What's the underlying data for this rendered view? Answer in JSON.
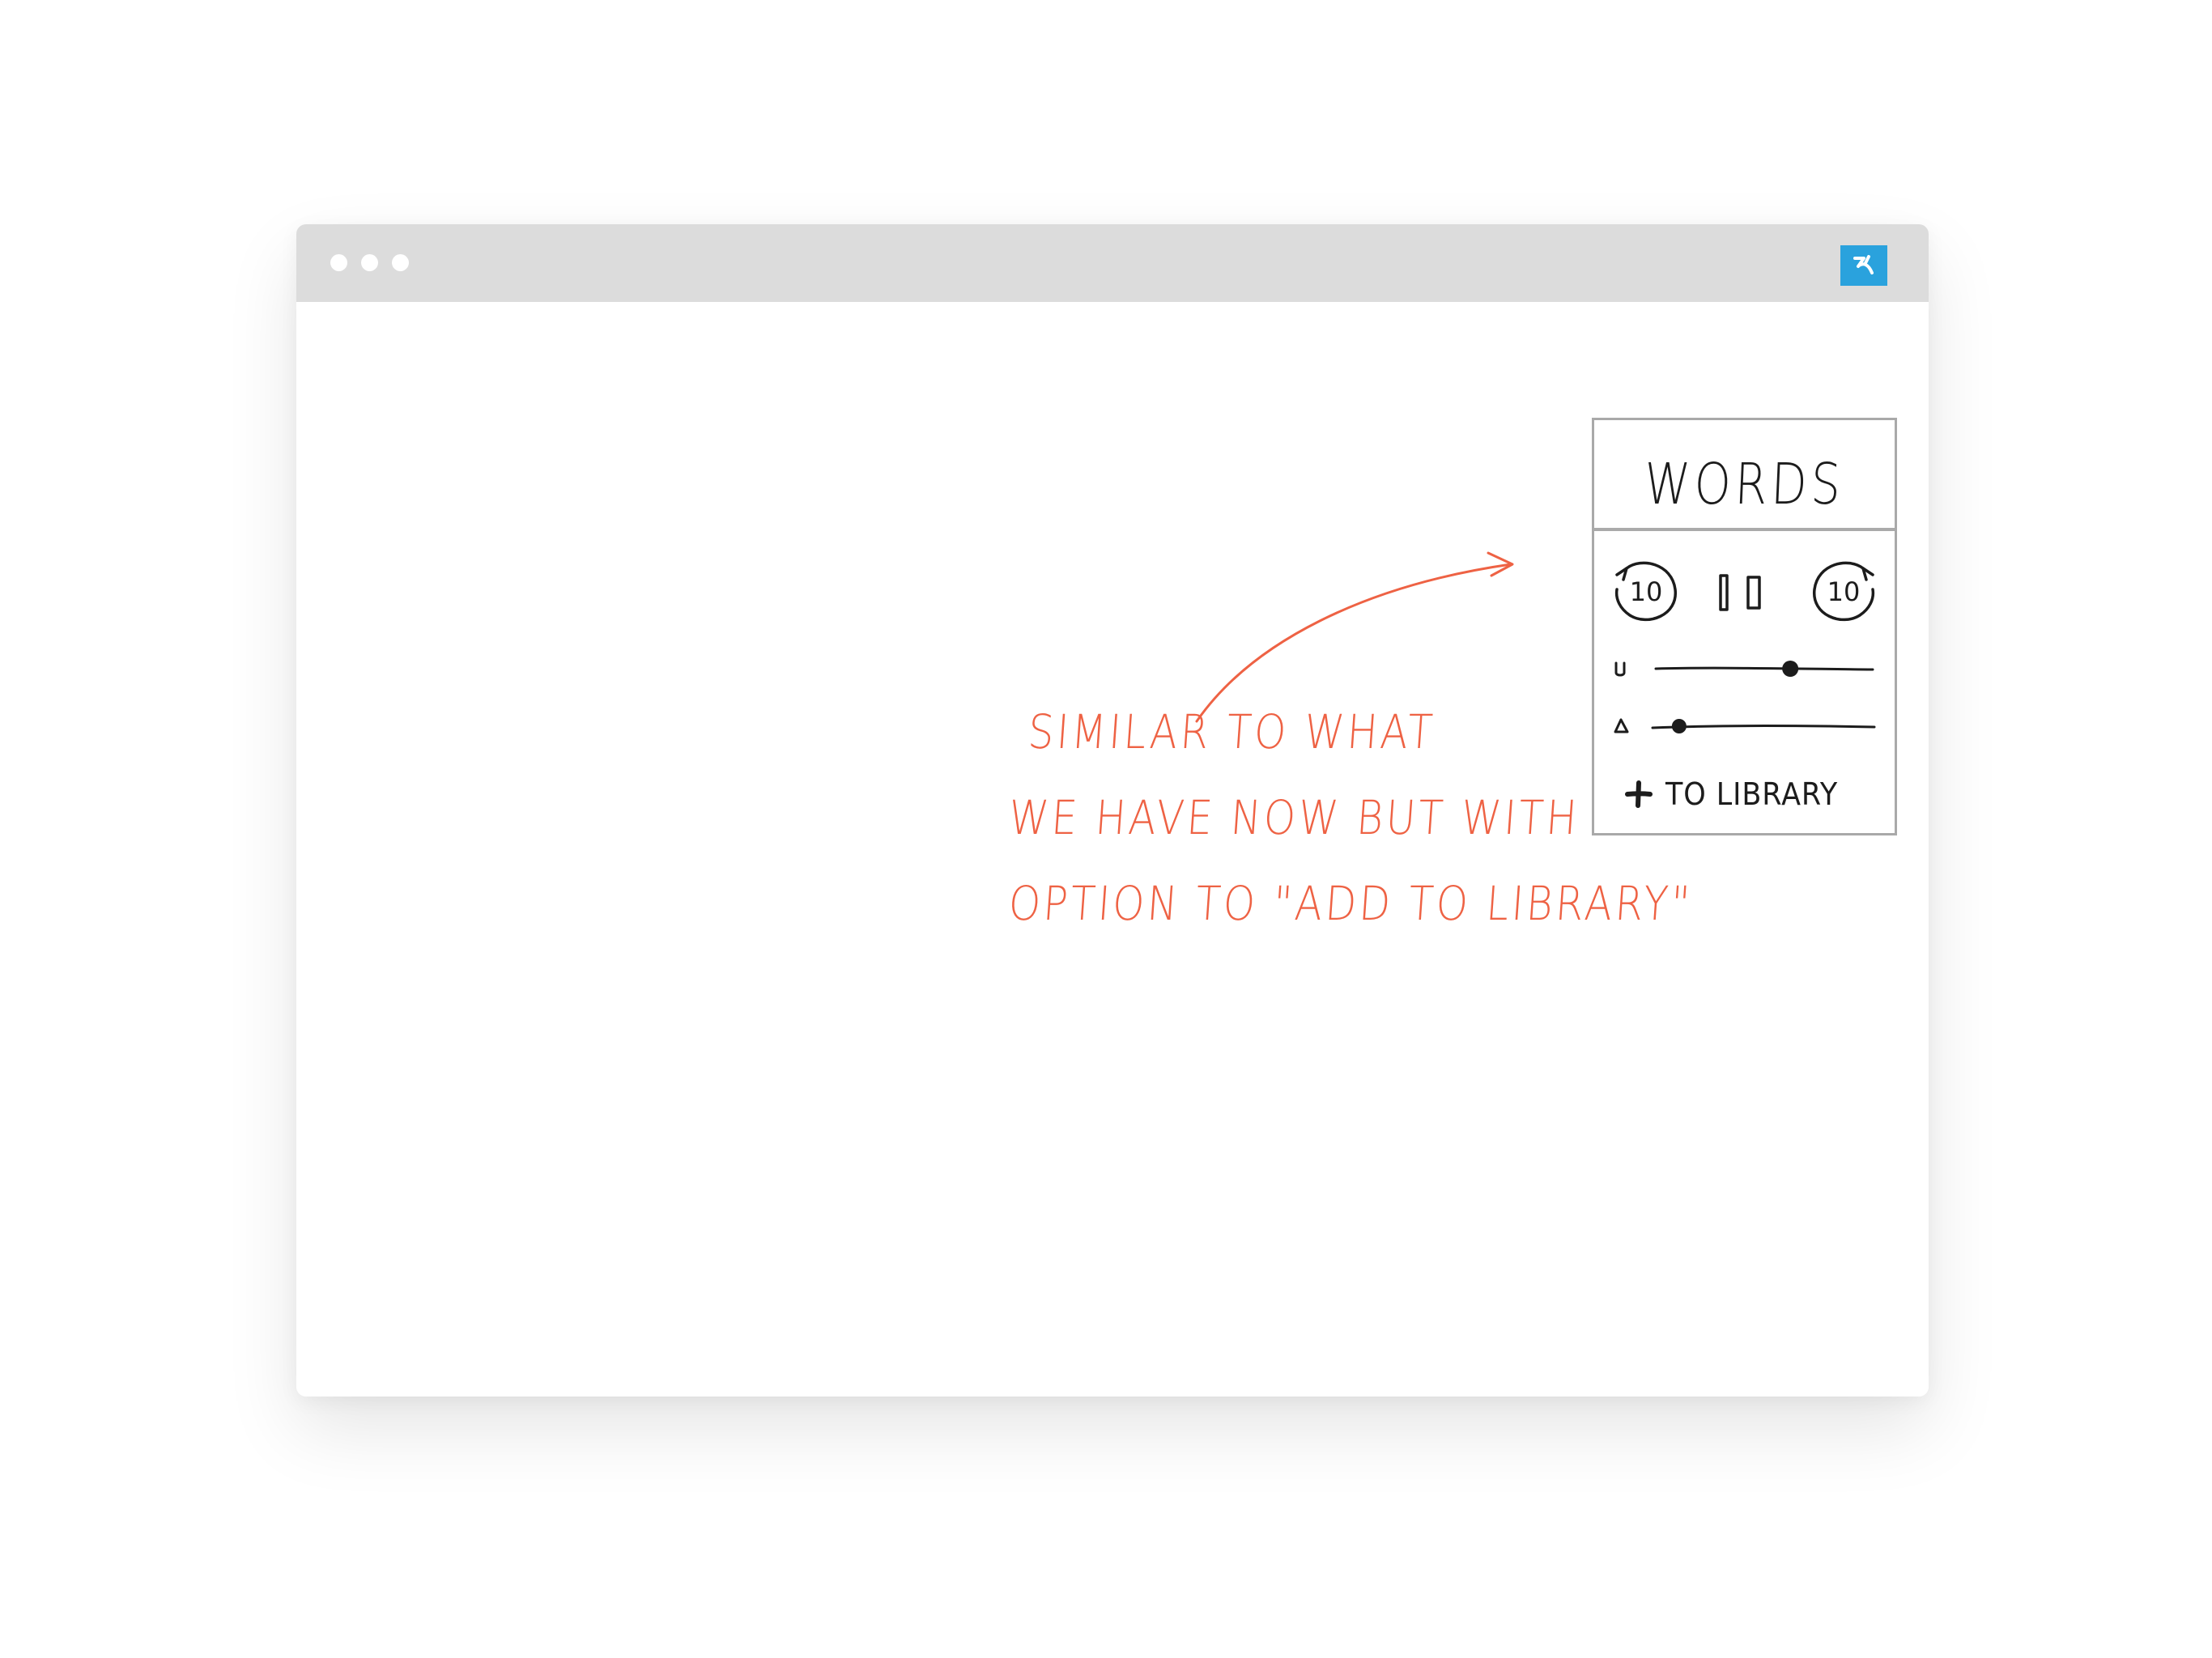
{
  "browser": {
    "window_dots": [
      "close-dot",
      "minimize-dot",
      "maximize-dot"
    ],
    "extension_icon": "extension-logo-icon",
    "extension_color": "#2aa2dd"
  },
  "widget": {
    "title": "WORDS",
    "controls": {
      "rewind_label": "10",
      "forward_label": "10",
      "rewind_icon": "rewind-10-icon",
      "pause_icon": "pause-icon",
      "forward_icon": "forward-10-icon"
    },
    "sliders": [
      {
        "icon": "speed-icon",
        "value": 0.62
      },
      {
        "icon": "voice-icon",
        "value": 0.12
      }
    ],
    "add_icon": "plus-icon",
    "add_label": "TO LIBRARY"
  },
  "annotation": {
    "color": "#ee6244",
    "lines": [
      "SIMILAR TO WHAT",
      "WE HAVE NOW BUT WITH",
      "OPTION TO \"ADD TO LIBRARY\""
    ]
  }
}
